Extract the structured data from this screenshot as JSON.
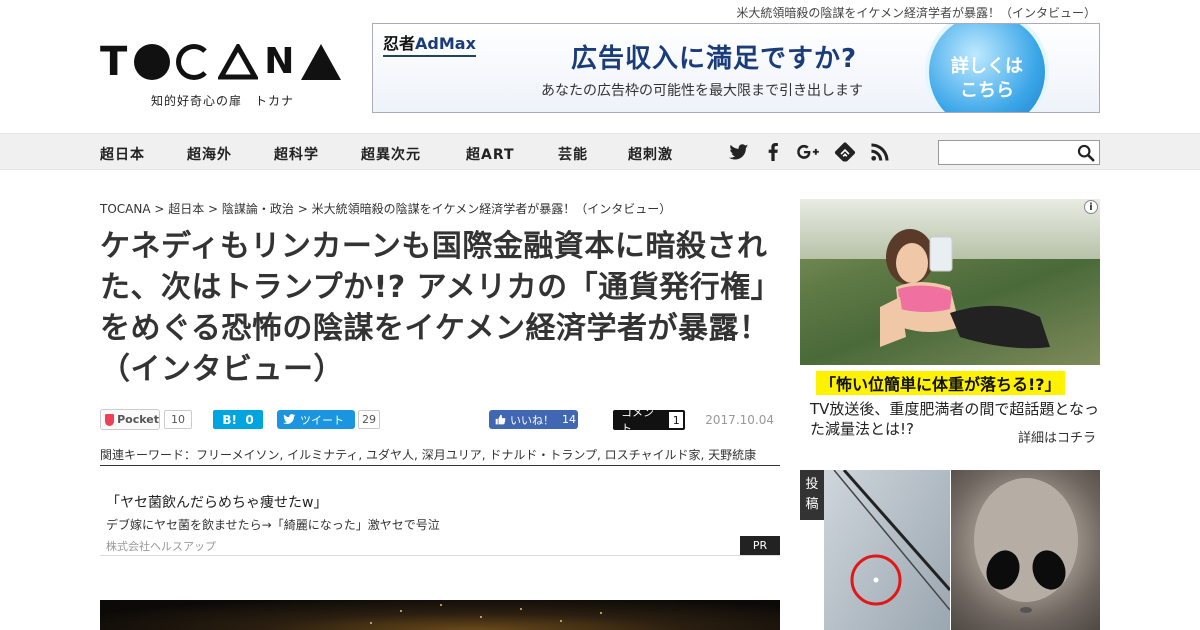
{
  "header": {
    "tagline": "米大統領暗殺の陰謀をイケメン経済学者が暴露！（インタビュー）",
    "logo_text": "TOCANA",
    "logo_subtitle": "知的好奇心の扉　トカナ"
  },
  "top_ad": {
    "brand_prefix": "忍者",
    "brand_suffix": "AdMax",
    "headline": "広告収入に満足ですか?",
    "subtext": "あなたの広告枠の可能性を最大限まで引き出します",
    "cta_line1": "詳しくは",
    "cta_line2": "こちら",
    "accent_color": "#1a3c7a"
  },
  "nav": {
    "items": [
      "超日本",
      "超海外",
      "超科学",
      "超異次元",
      "超ART",
      "芸能",
      "超刺激"
    ],
    "icons": [
      "twitter-icon",
      "facebook-icon",
      "google-plus-icon",
      "feedly-icon",
      "rss-icon"
    ],
    "search_placeholder": ""
  },
  "article": {
    "breadcrumb": "TOCANA > 超日本 > 陰謀論・政治 > 米大統領暗殺の陰謀をイケメン経済学者が暴露！（インタビュー）",
    "title": "ケネディもリンカーンも国際金融資本に暗殺された、次はトランプか!? アメリカの「通貨発行権」をめぐる恐怖の陰謀をイケメン経済学者が暴露！（インタビュー）",
    "date": "2017.10.04",
    "keywords": "関連キーワード：フリーメイソン, イルミナティ, ユダヤ人, 深月ユリア, ドナルド・トランプ, ロスチャイルド家, 天野統康"
  },
  "share": {
    "pocket_label": "Pocket",
    "pocket_count": "10",
    "hatena_label": "B!",
    "hatena_count": "0",
    "tweet_label": "ツイート",
    "tweet_count": "29",
    "like_label": "いいね！",
    "like_count": "14",
    "comment_label": "コメント",
    "comment_count": "1"
  },
  "pr": {
    "headline": "「ヤセ菌飲んだらめちゃ痩せたw」",
    "description": "デブ嫁にヤセ菌を飲ませたら→「綺麗になった」激ヤセで号泣",
    "sponsor": "株式会社ヘルスアップ",
    "badge": "PR"
  },
  "sidebar": {
    "ad_headline": "「怖い位簡単に体重が落ちる!?」",
    "ad_text": "TV放送後、重度肥満者の間で超話題となった減量法とは!?",
    "ad_more": "詳細はコチラ",
    "ad_info": "i",
    "card_tag_line1": "投",
    "card_tag_line2": "稿"
  }
}
